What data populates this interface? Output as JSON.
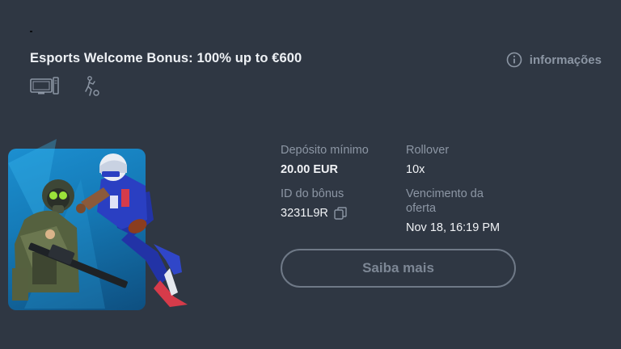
{
  "promo": {
    "title": "Esports Welcome Bonus: 100% up to €600",
    "info_label": "informações",
    "platform_icons": [
      "desktop-icon",
      "mobile-sport-icon"
    ]
  },
  "details": {
    "min_deposit_label": "Depósito mínimo",
    "min_deposit_value": "20.00 EUR",
    "rollover_label": "Rollover",
    "rollover_value": "10x",
    "bonus_id_label": "ID do bônus",
    "bonus_id_value": "3231L9R",
    "expiry_label_line1": "Vencimento da",
    "expiry_label_line2": "oferta",
    "expiry_value": "Nov 18, 16:19 PM"
  },
  "cta": {
    "label": "Saiba mais"
  },
  "colors": {
    "background": "#2f3743",
    "muted_text": "#8c96a4",
    "primary_text": "#eef1f5",
    "button_border": "#6f7987",
    "hero_blue": "#1c8fd0"
  }
}
